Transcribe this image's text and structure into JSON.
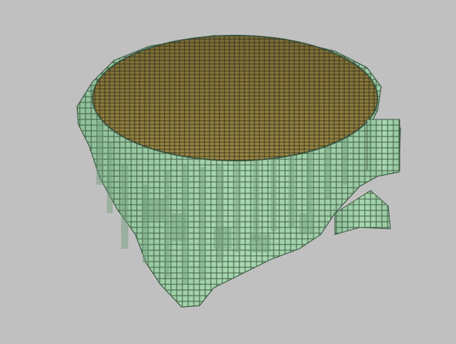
{
  "scene": {
    "background_color": "#c0c0c0",
    "colors": {
      "body_fill": "#a8d8b0",
      "body_shadow": "#6e9c78",
      "body_dark": "#3e5a44",
      "top_fill": "#8a7a3c",
      "top_light": "#a89448",
      "grid_line": "#2a2a1e"
    },
    "object": "voxel-cup"
  }
}
